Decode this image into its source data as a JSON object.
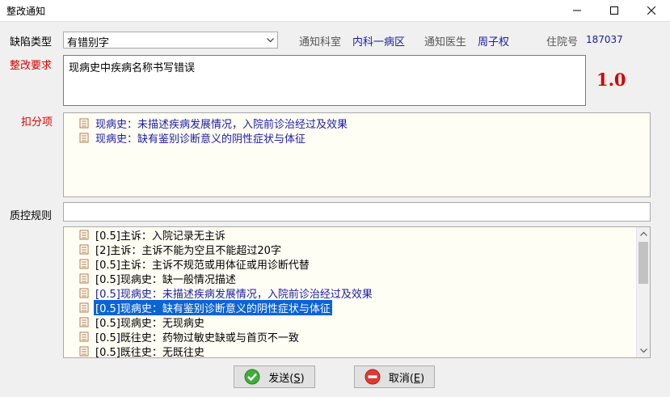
{
  "window": {
    "title": "整改通知"
  },
  "form": {
    "defect_type_label": "缺陷类型",
    "defect_type_value": "有错别字",
    "dept_label": "通知科室",
    "dept_value": "内科一病区",
    "doctor_label": "通知医生",
    "doctor_value": "周子权",
    "inpatient_label": "住院号",
    "inpatient_value": "187037",
    "req_label": "整改要求",
    "req_value": "现病史中疾病名称书写错误",
    "score": "1.0",
    "deduct_label": "扣分项",
    "qc_label": "质控规则"
  },
  "deduct_items": [
    "现病史：未描述疾病发展情况，入院前诊治经过及效果",
    "现病史：缺有鉴别诊断意义的阴性症状与体征"
  ],
  "rules": [
    "[0.5]主诉：入院记录无主诉",
    "[2]主诉：主诉不能为空且不能超过20字",
    "[0.5]主诉：主诉不规范或用体征或用诊断代替",
    "[0.5]现病史：缺一般情况描述",
    "[0.5]现病史：未描述疾病发展情况，入院前诊治经过及效果",
    "[0.5]现病史：缺有鉴别诊断意义的阴性症状与体征",
    "[0.5]现病史：无现病史",
    "[0.5]既往史：药物过敏史缺或与首页不一致",
    "[0.5]既往史：无既往史"
  ],
  "buttons": {
    "send_text": "发送(",
    "send_key": "S",
    "cancel_text": "取消(",
    "cancel_key": "E",
    "close_paren": ")"
  },
  "colors": {
    "accent_red": "#d40000",
    "link_blue": "#1a1aa6",
    "selection": "#0a64d6"
  }
}
